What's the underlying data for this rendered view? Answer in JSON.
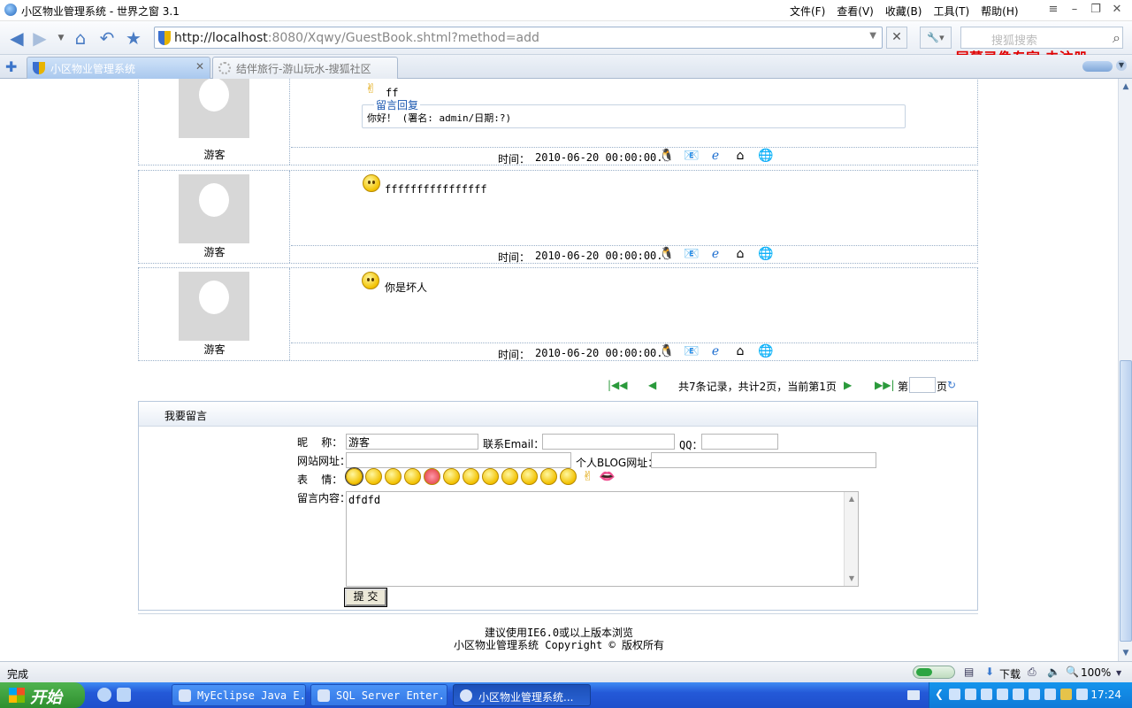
{
  "window": {
    "title": "小区物业管理系统 - 世界之窗 3.1",
    "menu": [
      "文件(F)",
      "查看(V)",
      "收藏(B)",
      "工具(T)",
      "帮助(H)"
    ]
  },
  "navbar": {
    "url_host": "http://localhost",
    "url_rest": ":8080/Xqwy/GuestBook.shtml?method=add",
    "search_placeholder": "搜狐搜索",
    "watermark": "屏幕录像专家  未注册"
  },
  "tabs": [
    {
      "label": "小区物业管理系统",
      "active": true
    },
    {
      "label": "结伴旅行-游山玩水-搜狐社区",
      "active": false
    }
  ],
  "messages": [
    {
      "nick": "游客",
      "text": "ff",
      "icon": "victory-hand-icon",
      "reply_title": "留言回复",
      "reply_text": "你好！ (署名: admin/日期:?)",
      "time_label": "时间：",
      "time": "2010-06-20 00:00:00.0"
    },
    {
      "nick": "游客",
      "text": "ffffffffffffffff",
      "icon": "smile-icon",
      "time_label": "时间：",
      "time": "2010-06-20 00:00:00.0"
    },
    {
      "nick": "游客",
      "text": "你是坏人",
      "icon": "smile-icon",
      "time_label": "时间：",
      "time": "2010-06-20 00:00:00.0"
    }
  ],
  "pager": {
    "info": "共7条记录，共计2页，当前第1页",
    "page_prefix": "第",
    "page_suffix": "页"
  },
  "form": {
    "header": "我要留言",
    "nickname_label": "昵    称：",
    "nickname_value": "游客",
    "email_label": "联系Email：",
    "qq_label": "QQ：",
    "website_label": "网站网址：",
    "blog_label": "个人BLOG网址：",
    "emotion_label": "表    情：",
    "content_label": "留言内容：",
    "content_value": "dfdfd",
    "submit_label": "提 交"
  },
  "footer": {
    "line1": "建议使用IE6.0或以上版本浏览",
    "line2": "小区物业管理系统 Copyright © 版权所有"
  },
  "statusbar": {
    "status": "完成",
    "download": "下载",
    "zoom": "100%"
  },
  "taskbar": {
    "start": "开始",
    "tasks": [
      "MyEclipse Java E...",
      "SQL Server Enter...",
      "小区物业管理系统..."
    ],
    "clock": "17:24"
  },
  "colors": {
    "taskbar": "#2459d8",
    "start": "#2f8f2f",
    "link_blue": "#1a57b0",
    "watermark": "#e00000"
  }
}
